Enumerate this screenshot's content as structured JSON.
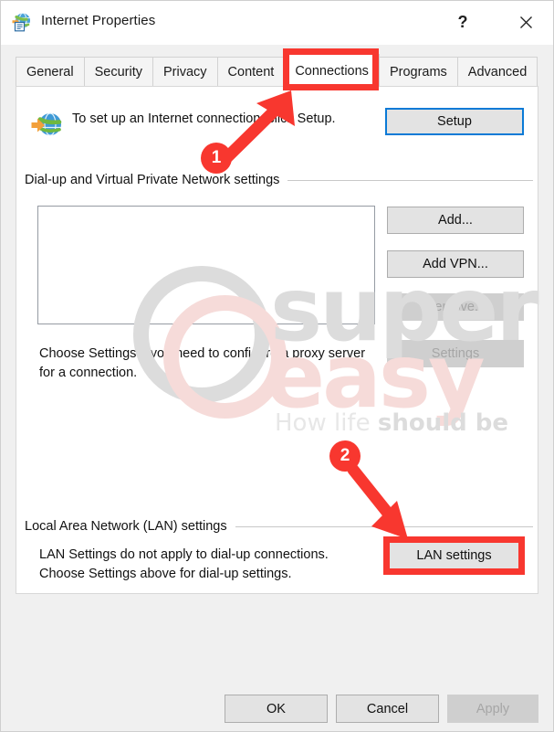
{
  "window": {
    "title": "Internet Properties",
    "icon": "internet-properties-icon",
    "help_label": "?",
    "close_label": "✕"
  },
  "tabs": [
    {
      "label": "General",
      "active": false
    },
    {
      "label": "Security",
      "active": false
    },
    {
      "label": "Privacy",
      "active": false
    },
    {
      "label": "Content",
      "active": false
    },
    {
      "label": "Connections",
      "active": true
    },
    {
      "label": "Programs",
      "active": false
    },
    {
      "label": "Advanced",
      "active": false
    }
  ],
  "connections": {
    "setup_description": "To set up an Internet connection, click Setup.",
    "setup_button": "Setup",
    "dialup_group_label": "Dial-up and Virtual Private Network settings",
    "dialup_list_items": [],
    "add_button": "Add...",
    "add_vpn_button": "Add VPN...",
    "remove_button": "Remove...",
    "settings_button": "Settings",
    "proxy_description": "Choose Settings if you need to configure a proxy server for a connection.",
    "lan_group_label": "Local Area Network (LAN) settings",
    "lan_description": "LAN Settings do not apply to dial-up connections. Choose Settings above for dial-up settings.",
    "lan_settings_button": "LAN settings"
  },
  "footer": {
    "ok_label": "OK",
    "cancel_label": "Cancel",
    "apply_label": "Apply"
  },
  "annotations": {
    "color": "#f8372f",
    "badge_one": "1",
    "badge_two": "2"
  },
  "watermark": {
    "word_one": "super",
    "word_two": "easy",
    "tagline_light": "How life ",
    "tagline_bold": "should be",
    "color_gray": "#dcdcdc",
    "color_pink": "#f6dbd9"
  }
}
